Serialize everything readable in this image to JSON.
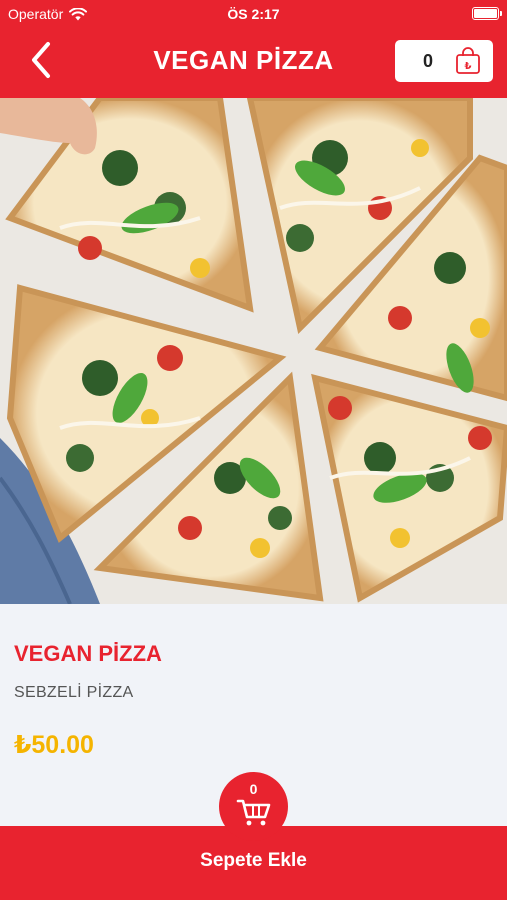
{
  "status_bar": {
    "carrier": "Operatör",
    "time": "ÖS 2:17"
  },
  "header": {
    "title": "VEGAN PİZZA",
    "cart_count": "0"
  },
  "hero": {
    "alt": "Vegan pizza slices"
  },
  "product": {
    "name": "VEGAN PİZZA",
    "description": "SEBZELİ PİZZA",
    "price": "₺50.00"
  },
  "fab": {
    "count": "0"
  },
  "bottom": {
    "add_to_cart_label": "Sepete Ekle"
  },
  "colors": {
    "accent": "#e8232f",
    "price": "#f5b400",
    "background": "#f1f3f8"
  }
}
